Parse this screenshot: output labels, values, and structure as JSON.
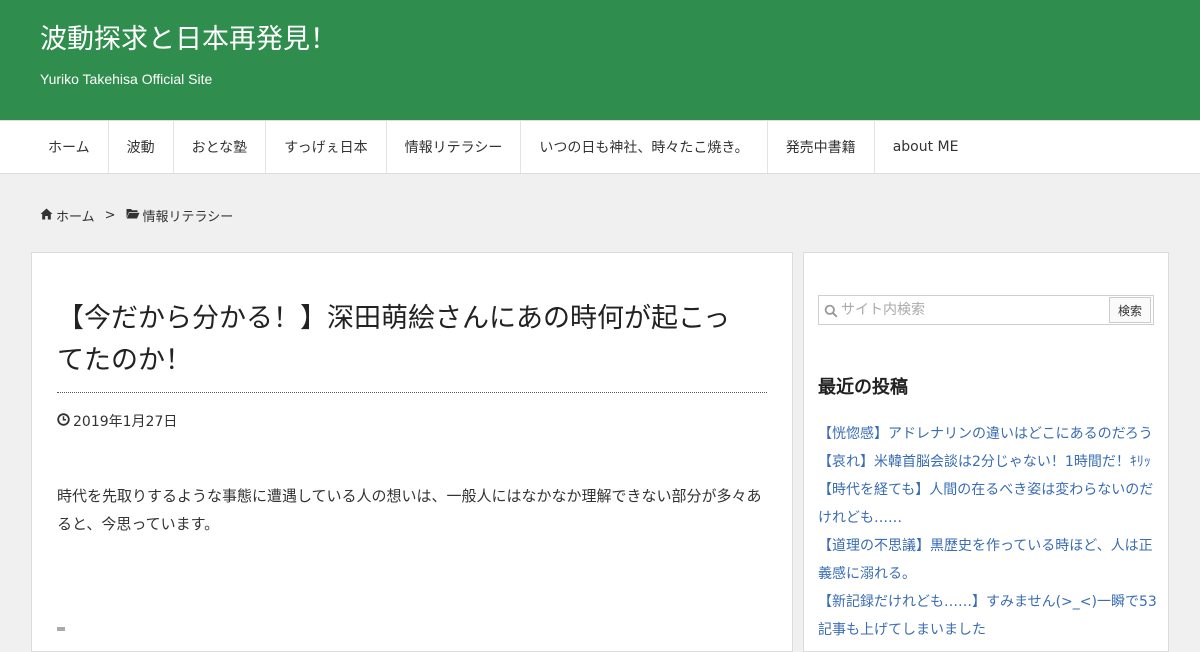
{
  "header": {
    "site_title": "波動探求と日本再発見！",
    "site_description": "Yuriko Takehisa Official Site",
    "bg_color": "#2f8e4d"
  },
  "nav": {
    "items": [
      {
        "label": "ホーム"
      },
      {
        "label": "波動"
      },
      {
        "label": "おとな塾"
      },
      {
        "label": "すっげぇ日本"
      },
      {
        "label": "情報リテラシー"
      },
      {
        "label": "いつの日も神社、時々たこ焼き。"
      },
      {
        "label": "発売中書籍"
      },
      {
        "label": "about ME"
      }
    ]
  },
  "breadcrumb": {
    "home_icon": "home-icon",
    "home": "ホーム",
    "separator": ">",
    "category_icon": "folder-open-icon",
    "category": "情報リテラシー"
  },
  "post": {
    "title": "【今だから分かる！】深田萌絵さんにあの時何が起こってたのか！",
    "date_icon": "clock-icon",
    "date": "2019年1月27日",
    "body": "時代を先取りするような事態に遭遇している人の想いは、一般人にはなかなか理解できない部分が多々あると、今思っています。"
  },
  "sidebar": {
    "search": {
      "icon": "search-icon",
      "placeholder": "サイト内検索",
      "button_label": "検索"
    },
    "recent_title": "最近の投稿",
    "recent_posts": [
      "【恍惚感】アドレナリンの違いはどこにあるのだろう",
      "【哀れ】米韓首脳会談は2分じゃない！1時間だ！ｷﾘｯ",
      "【時代を経ても】人間の在るべき姿は変わらないのだけれども……",
      "【道理の不思議】黒歴史を作っている時ほど、人は正義感に溺れる。",
      "【新記録だけれども……】すみません(>_<)一瞬で53記事も上げてしまいました"
    ],
    "link_color": "#3a6db3"
  }
}
